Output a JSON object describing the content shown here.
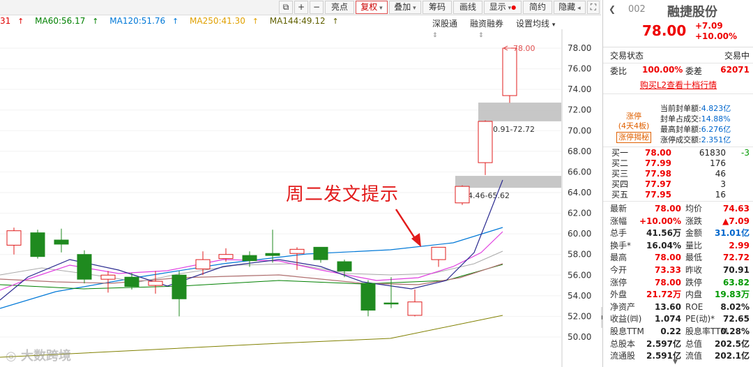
{
  "toolbar": {
    "buttons": [
      "亮点",
      "复权",
      "叠加",
      "筹码",
      "画线",
      "显示",
      "简约",
      "隐藏"
    ],
    "active": "复权"
  },
  "ma_legend": [
    {
      "label": "31",
      "color": "#e00000"
    },
    {
      "label": "MA60:56.17",
      "color": "#008000"
    },
    {
      "label": "MA120:51.76",
      "color": "#0078d7"
    },
    {
      "label": "MA250:41.30",
      "color": "#e0a000"
    },
    {
      "label": "MA144:49.12",
      "color": "#606000"
    }
  ],
  "chart_links": {
    "a": "深股通",
    "b": "融资融券",
    "c": "设置均线"
  },
  "annotation": "周二发文提示",
  "watermark": "大数跨境",
  "chart_data": {
    "type": "candlestick",
    "y_ticks": [
      "78.00",
      "76.00",
      "74.00",
      "72.00",
      "70.00",
      "68.00",
      "66.00",
      "64.00",
      "62.00",
      "60.00",
      "58.00",
      "56.00",
      "54.00",
      "52.00",
      "50.00"
    ],
    "ylim": [
      49,
      79.5
    ],
    "candles": [
      {
        "o": 58.9,
        "c": 60.3,
        "h": 60.6,
        "l": 58.0
      },
      {
        "o": 60.1,
        "c": 57.8,
        "h": 60.4,
        "l": 57.6
      },
      {
        "o": 59.4,
        "c": 59.0,
        "h": 60.5,
        "l": 58.2
      },
      {
        "o": 58.0,
        "c": 55.6,
        "h": 58.4,
        "l": 55.2
      },
      {
        "o": 55.6,
        "c": 56.0,
        "h": 56.4,
        "l": 54.3
      },
      {
        "o": 55.8,
        "c": 54.9,
        "h": 56.2,
        "l": 54.6
      },
      {
        "o": 55.0,
        "c": 55.4,
        "h": 56.4,
        "l": 54.2
      },
      {
        "o": 56.0,
        "c": 53.7,
        "h": 56.4,
        "l": 52.0
      },
      {
        "o": 56.6,
        "c": 57.5,
        "h": 58.3,
        "l": 56.0
      },
      {
        "o": 57.6,
        "c": 58.0,
        "h": 58.6,
        "l": 57.3
      },
      {
        "o": 57.9,
        "c": 57.4,
        "h": 58.3,
        "l": 56.8
      },
      {
        "o": 58.1,
        "c": 57.9,
        "h": 60.4,
        "l": 57.2
      },
      {
        "o": 58.1,
        "c": 58.5,
        "h": 58.7,
        "l": 56.5
      },
      {
        "o": 58.7,
        "c": 57.5,
        "h": 58.7,
        "l": 57.2
      },
      {
        "o": 57.3,
        "c": 56.4,
        "h": 57.5,
        "l": 55.8
      },
      {
        "o": 55.2,
        "c": 52.6,
        "h": 55.5,
        "l": 52.0
      },
      {
        "o": 53.3,
        "c": 53.2,
        "h": 55.8,
        "l": 52.8
      },
      {
        "o": 52.1,
        "c": 53.4,
        "h": 54.6,
        "l": 52.0
      },
      {
        "o": 57.5,
        "c": 58.7,
        "h": 58.7,
        "l": 56.8
      },
      {
        "o": 63.0,
        "c": 64.6,
        "h": 64.7,
        "l": 62.8
      },
      {
        "o": 66.9,
        "c": 70.9,
        "h": 71.0,
        "l": 65.7
      },
      {
        "o": 73.4,
        "c": 78.0,
        "h": 78.0,
        "l": 72.7
      }
    ],
    "gaps": [
      {
        "label": "64.46-65.62",
        "low": 64.46,
        "high": 65.62
      },
      {
        "label": "70.91-72.72",
        "low": 70.91,
        "high": 72.72
      }
    ],
    "high_marker": "78.00"
  },
  "quote": {
    "code": "002",
    "name": "融捷股份",
    "price": "78.00",
    "change": "+7.09",
    "change_pct": "+10.00%",
    "status_label": "交易状态",
    "status_value": "交易中",
    "weibi_label": "委比",
    "weibi_value": "100.00%",
    "weicha_label": "委差",
    "weicha_value": "62071",
    "l2_link": "购买L2查看十档行情"
  },
  "limit_up": {
    "badge_top": "涨停",
    "badge_mid": "(4天4板)",
    "badge_btn": "涨停揭秘",
    "items": [
      {
        "k": "当前封单额:",
        "v": "4.823亿"
      },
      {
        "k": "封单占成交:",
        "v": "14.88%"
      },
      {
        "k": "最高封单额:",
        "v": "6.276亿"
      },
      {
        "k": "涨停成交额:",
        "v": "2.351亿"
      }
    ]
  },
  "order_book": [
    {
      "label": "买一",
      "price": "78.00",
      "vol": "61830",
      "chg": "-3"
    },
    {
      "label": "买二",
      "price": "77.99",
      "vol": "176",
      "chg": ""
    },
    {
      "label": "买三",
      "price": "77.98",
      "vol": "46",
      "chg": ""
    },
    {
      "label": "买四",
      "price": "77.97",
      "vol": "3",
      "chg": ""
    },
    {
      "label": "买五",
      "price": "77.95",
      "vol": "16",
      "chg": ""
    }
  ],
  "stats": [
    {
      "k1": "最新",
      "v1": "78.00",
      "c1": "red",
      "k2": "均价",
      "v2": "74.63",
      "c2": "red"
    },
    {
      "k1": "涨幅",
      "v1": "+10.00%",
      "c1": "red",
      "k2": "涨跌",
      "v2": "▲7.09",
      "c2": "red"
    },
    {
      "k1": "总手",
      "v1": "41.56万",
      "c1": "",
      "k2": "金额",
      "v2": "31.01亿",
      "c2": "blue"
    },
    {
      "k1": "换手*",
      "v1": "16.04%",
      "c1": "",
      "k2": "量比",
      "v2": "2.99",
      "c2": "red"
    },
    {
      "k1": "最高",
      "v1": "78.00",
      "c1": "red",
      "k2": "最低",
      "v2": "72.72",
      "c2": "red"
    },
    {
      "k1": "今开",
      "v1": "73.33",
      "c1": "red",
      "k2": "昨收",
      "v2": "70.91",
      "c2": ""
    },
    {
      "k1": "涨停",
      "v1": "78.00",
      "c1": "red",
      "k2": "跌停",
      "v2": "63.82",
      "c2": "green"
    },
    {
      "k1": "外盘",
      "v1": "21.72万",
      "c1": "red",
      "k2": "内盘",
      "v2": "19.83万",
      "c2": "green"
    },
    {
      "k1": "净资产",
      "v1": "13.60",
      "c1": "",
      "k2": "ROE",
      "v2": "8.02%",
      "c2": ""
    },
    {
      "k1": "收益(㈣)",
      "v1": "1.074",
      "c1": "",
      "k2": "PE(动)*",
      "v2": "72.65",
      "c2": ""
    },
    {
      "k1": "股息TTM",
      "v1": "0.22",
      "c1": "",
      "k2": "股息率TTM",
      "v2": "0.28%",
      "c2": ""
    },
    {
      "k1": "总股本",
      "v1": "2.597亿",
      "c1": "",
      "k2": "总值",
      "v2": "202.5亿",
      "c2": ""
    },
    {
      "k1": "流通股",
      "v1": "2.591亿",
      "c1": "",
      "k2": "流值",
      "v2": "202.1亿",
      "c2": ""
    }
  ]
}
